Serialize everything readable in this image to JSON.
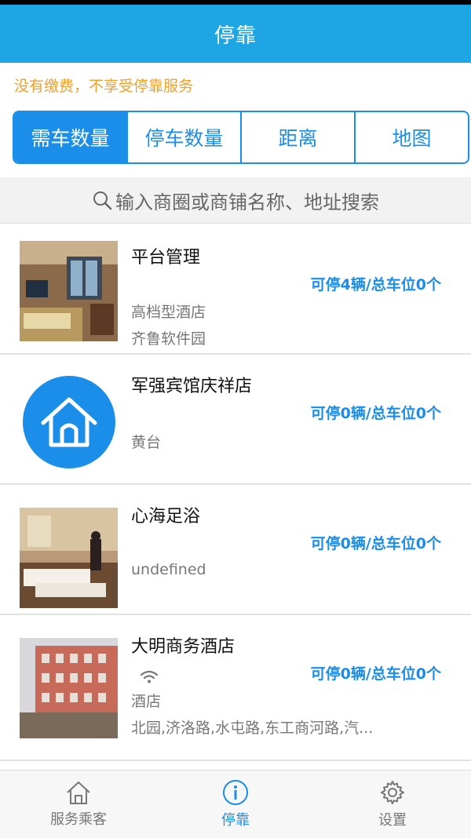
{
  "header": {
    "title": "停靠"
  },
  "notice": "没有缴费，不享受停靠服务",
  "tabs": [
    {
      "label": "需车数量",
      "active": true
    },
    {
      "label": "停车数量",
      "active": false
    },
    {
      "label": "距离",
      "active": false
    },
    {
      "label": "地图",
      "active": false
    }
  ],
  "search": {
    "placeholder": "输入商圈或商铺名称、地址搜索",
    "icon": "search-icon"
  },
  "items": [
    {
      "name": "平台管理",
      "availability": "可停4辆/总车位0个",
      "line1": "高档型酒店",
      "line2": "齐鲁软件园"
    },
    {
      "name": "军强宾馆庆祥店",
      "availability": "可停0辆/总车位0个",
      "line1": "黄台",
      "icon": "home-icon"
    },
    {
      "name": "心海足浴",
      "availability": "可停0辆/总车位0个",
      "line1": "undefined"
    },
    {
      "name": "大明商务酒店",
      "availability": "可停0辆/总车位0个",
      "line1": "酒店",
      "line2": "北园,济洛路,水屯路,东工商河路,汽...",
      "icon": "wifi-icon"
    }
  ],
  "bottom_nav": [
    {
      "label": "服务乘客",
      "icon": "home-outline-icon",
      "active": false
    },
    {
      "label": "停靠",
      "icon": "info-icon",
      "active": true
    },
    {
      "label": "设置",
      "icon": "gear-icon",
      "active": false
    }
  ],
  "colors": {
    "header": "#1ea6e4",
    "accent": "#1a8ee8",
    "notice": "#f0a02a"
  }
}
